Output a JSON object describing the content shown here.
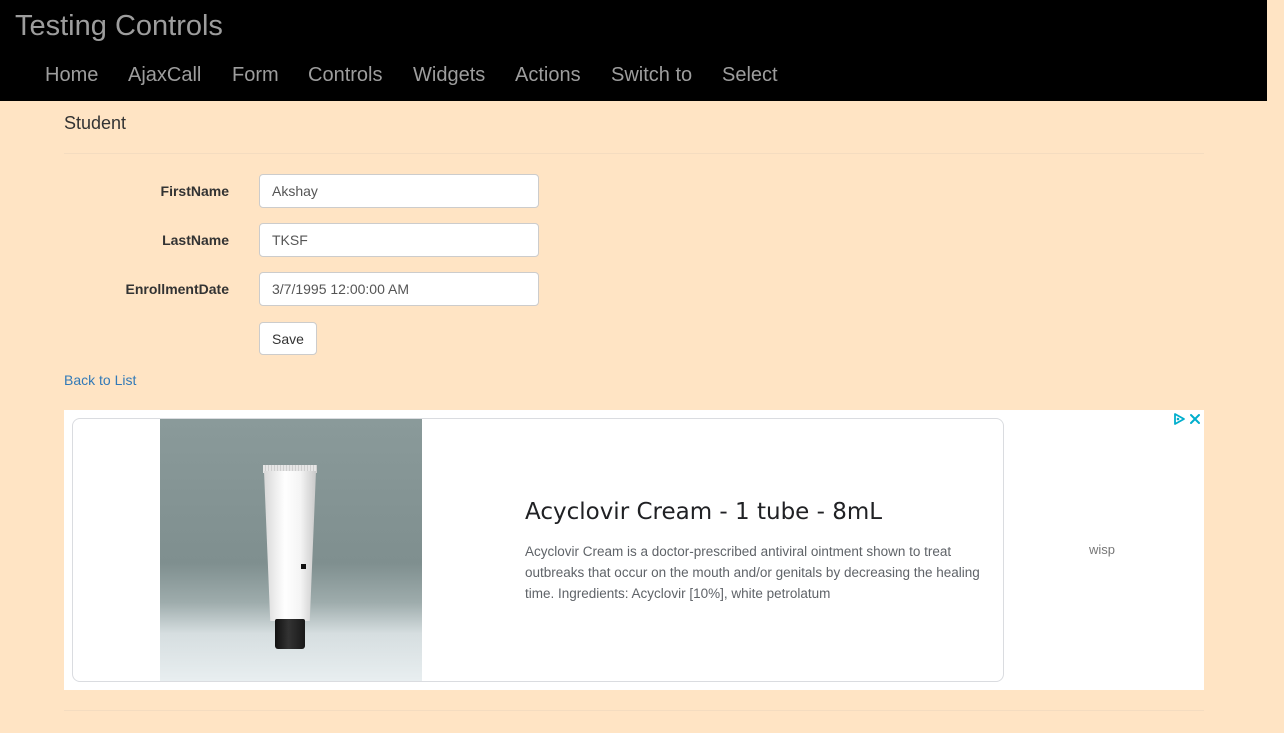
{
  "navbar": {
    "brand": "Testing Controls",
    "items": [
      {
        "label": "Home"
      },
      {
        "label": "AjaxCall"
      },
      {
        "label": "Form"
      },
      {
        "label": "Controls"
      },
      {
        "label": "Widgets"
      },
      {
        "label": "Actions"
      },
      {
        "label": "Switch to"
      },
      {
        "label": "Select"
      }
    ]
  },
  "page": {
    "heading": "Student"
  },
  "form": {
    "fields": [
      {
        "label": "FirstName",
        "value": "Akshay"
      },
      {
        "label": "LastName",
        "value": "TKSF"
      },
      {
        "label": "EnrollmentDate",
        "value": "3/7/1995 12:00:00 AM"
      }
    ],
    "save_label": "Save"
  },
  "back_link": "Back to List",
  "ad": {
    "title": "Acyclovir Cream - 1 tube - 8mL",
    "description": "Acyclovir Cream is a doctor-prescribed antiviral ointment shown to treat outbreaks that occur on the mouth and/or genitals by decreasing the healing time. Ingredients: Acyclovir [10%], white petrolatum",
    "advertiser": "wisp",
    "adchoices_icon": "adchoices-icon",
    "close_icon": "close-icon",
    "accent_color": "#00aecd"
  },
  "colors": {
    "page_background": "#ffe4c4",
    "navbar_background": "#000000",
    "nav_text": "#9d9d9d",
    "link": "#337ab7"
  }
}
